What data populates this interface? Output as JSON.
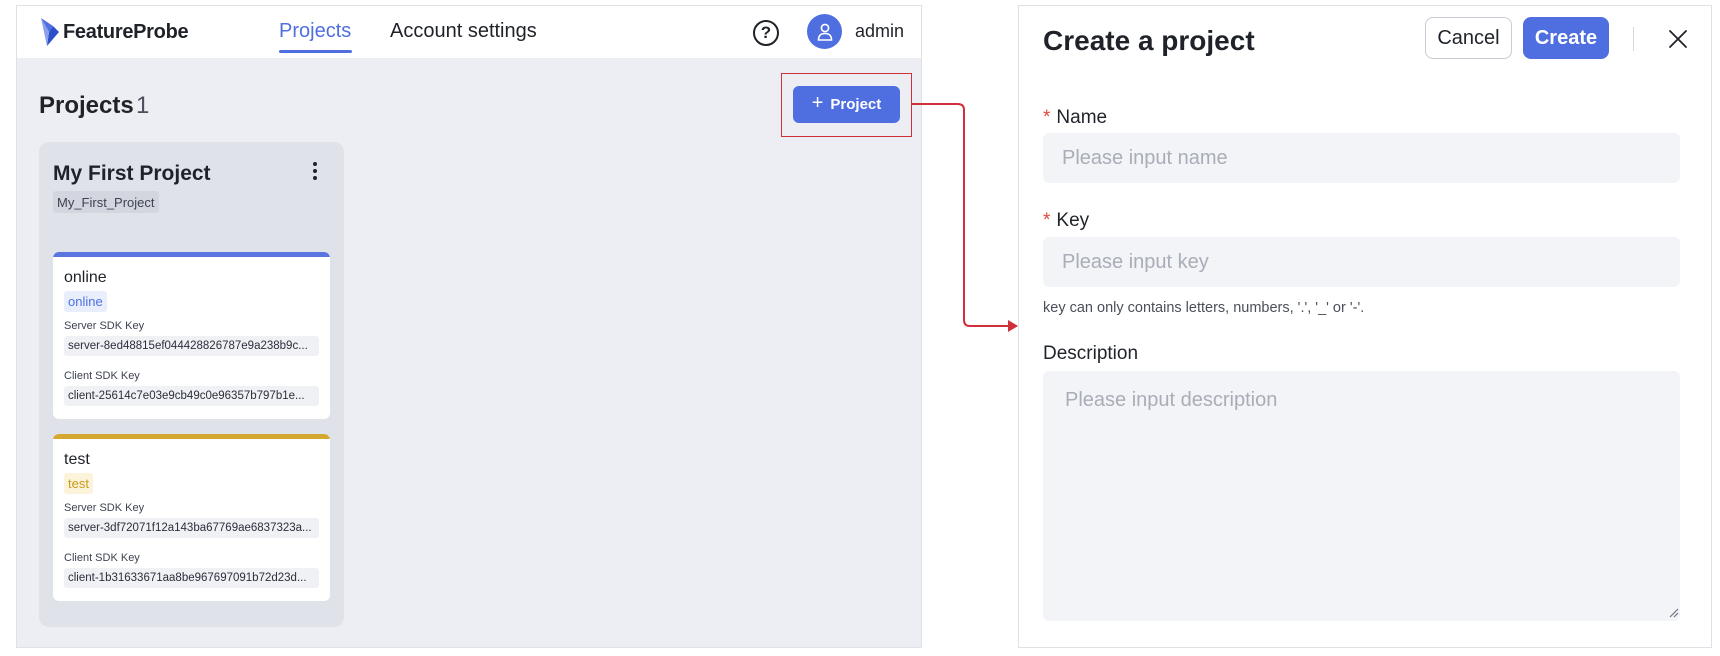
{
  "app": {
    "logo_text": "FeatureProbe",
    "nav": {
      "projects": "Projects",
      "account_settings": "Account settings"
    },
    "help_glyph": "?",
    "user": {
      "name": "admin"
    }
  },
  "projects_page": {
    "title": "Projects",
    "count": "1",
    "add_button": {
      "icon": "+",
      "label": "Project"
    },
    "projects": [
      {
        "name": "My First Project",
        "key": "My_First_Project",
        "environments": [
          {
            "name": "online",
            "tag": "online",
            "color": "#5a75e0",
            "tag_bg": "#e9eefc",
            "tag_fg": "#4f6fe0",
            "server_sdk_label": "Server SDK Key",
            "server_sdk_key": "server-8ed48815ef044428826787e9a238b9c...",
            "client_sdk_label": "Client SDK Key",
            "client_sdk_key": "client-25614c7e03e9cb49c0e96357b797b1e..."
          },
          {
            "name": "test",
            "tag": "test",
            "color": "#d4a82e",
            "tag_bg": "#fcf4da",
            "tag_fg": "#c99a1c",
            "server_sdk_label": "Server SDK Key",
            "server_sdk_key": "server-3df72071f12a143ba67769ae6837323a...",
            "client_sdk_label": "Client SDK Key",
            "client_sdk_key": "client-1b31633671aa8be967697091b72d23d..."
          }
        ]
      }
    ]
  },
  "modal": {
    "title": "Create a project",
    "cancel_label": "Cancel",
    "create_label": "Create",
    "fields": {
      "name": {
        "label": "Name",
        "required": "*",
        "placeholder": "Please input name",
        "value": ""
      },
      "key": {
        "label": "Key",
        "required": "*",
        "placeholder": "Please input key",
        "value": "",
        "hint": "key can only contains letters, numbers, '.', '_' or '-'."
      },
      "description": {
        "label": "Description",
        "placeholder": "Please input description",
        "value": ""
      }
    }
  },
  "colors": {
    "accent": "#4f6fe0",
    "highlight_border": "#d0303a",
    "required": "#e04a3c"
  }
}
